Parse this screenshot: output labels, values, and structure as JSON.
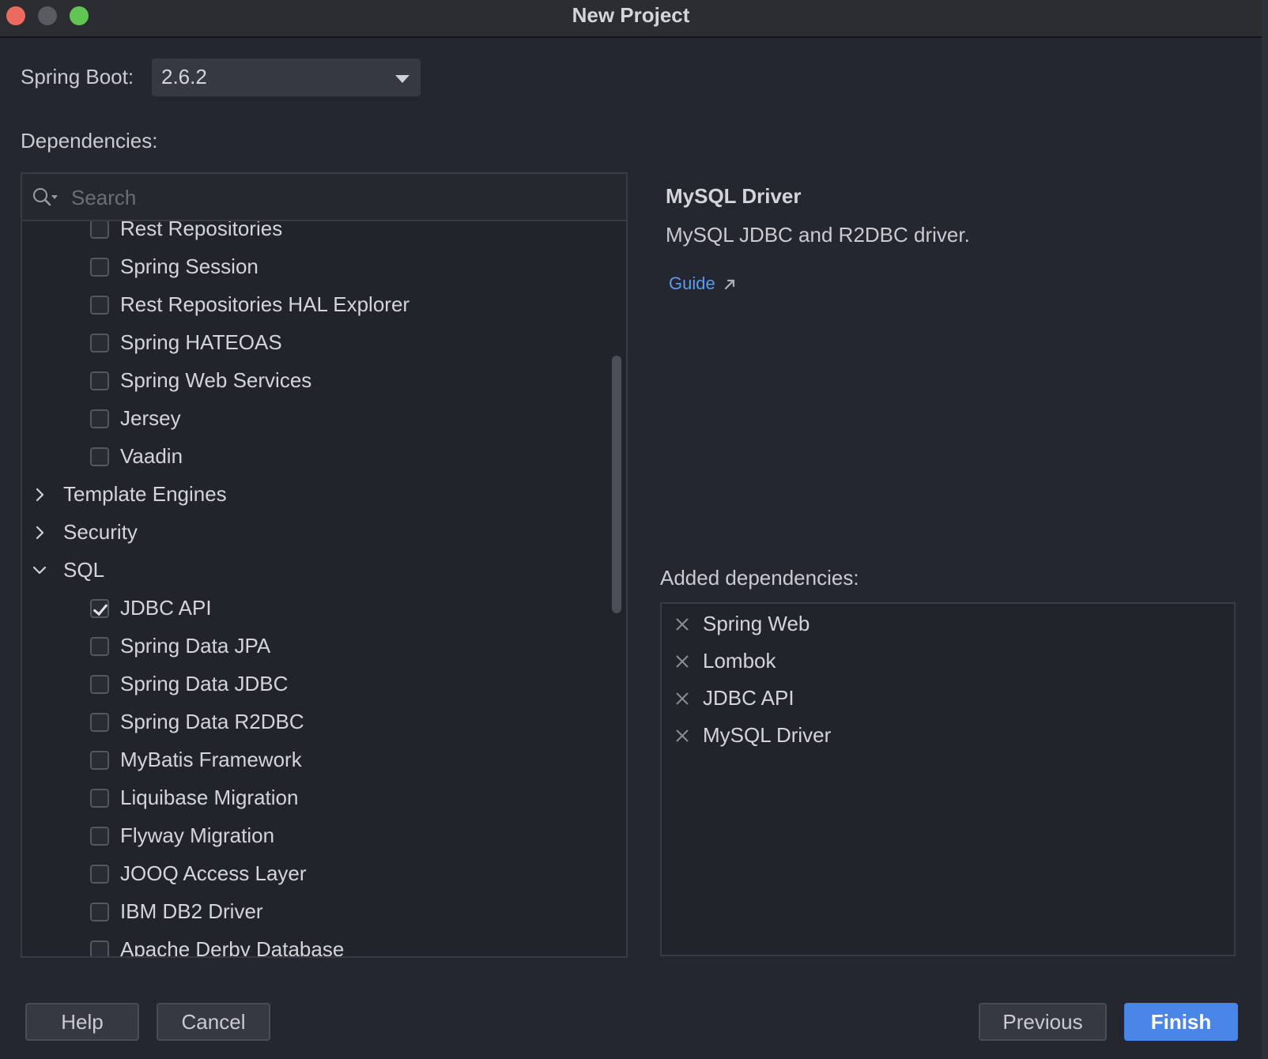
{
  "window": {
    "title": "New Project"
  },
  "spring_boot": {
    "label": "Spring Boot:",
    "value": "2.6.2"
  },
  "dependencies": {
    "label": "Dependencies:",
    "search_placeholder": "Search",
    "tree": [
      {
        "label": "Rest Repositories",
        "type": "checkbox",
        "checked": false
      },
      {
        "label": "Spring Session",
        "type": "checkbox",
        "checked": false
      },
      {
        "label": "Rest Repositories HAL Explorer",
        "type": "checkbox",
        "checked": false
      },
      {
        "label": "Spring HATEOAS",
        "type": "checkbox",
        "checked": false
      },
      {
        "label": "Spring Web Services",
        "type": "checkbox",
        "checked": false
      },
      {
        "label": "Jersey",
        "type": "checkbox",
        "checked": false
      },
      {
        "label": "Vaadin",
        "type": "checkbox",
        "checked": false
      },
      {
        "label": "Template Engines",
        "type": "category",
        "expanded": false
      },
      {
        "label": "Security",
        "type": "category",
        "expanded": false
      },
      {
        "label": "SQL",
        "type": "category",
        "expanded": true
      },
      {
        "label": "JDBC API",
        "type": "checkbox",
        "checked": true
      },
      {
        "label": "Spring Data JPA",
        "type": "checkbox",
        "checked": false
      },
      {
        "label": "Spring Data JDBC",
        "type": "checkbox",
        "checked": false
      },
      {
        "label": "Spring Data R2DBC",
        "type": "checkbox",
        "checked": false
      },
      {
        "label": "MyBatis Framework",
        "type": "checkbox",
        "checked": false
      },
      {
        "label": "Liquibase Migration",
        "type": "checkbox",
        "checked": false
      },
      {
        "label": "Flyway Migration",
        "type": "checkbox",
        "checked": false
      },
      {
        "label": "JOOQ Access Layer",
        "type": "checkbox",
        "checked": false
      },
      {
        "label": "IBM DB2 Driver",
        "type": "checkbox",
        "checked": false
      },
      {
        "label": "Apache Derby Database",
        "type": "checkbox",
        "checked": false
      }
    ]
  },
  "detail": {
    "title": "MySQL Driver",
    "description": "MySQL JDBC and R2DBC driver.",
    "link": "Guide"
  },
  "added": {
    "label": "Added dependencies:",
    "items": [
      "Spring Web",
      "Lombok",
      "JDBC API",
      "MySQL Driver"
    ]
  },
  "buttons": {
    "help": "Help",
    "cancel": "Cancel",
    "previous": "Previous",
    "finish": "Finish"
  },
  "icons": {
    "search": "search-icon",
    "remove": "close-icon",
    "expand": "chevron-right-icon",
    "collapse": "chevron-down-icon",
    "external": "arrow-up-right-icon"
  },
  "colors": {
    "accent": "#4a86e8",
    "link": "#5d9af0",
    "background": "#242630"
  }
}
